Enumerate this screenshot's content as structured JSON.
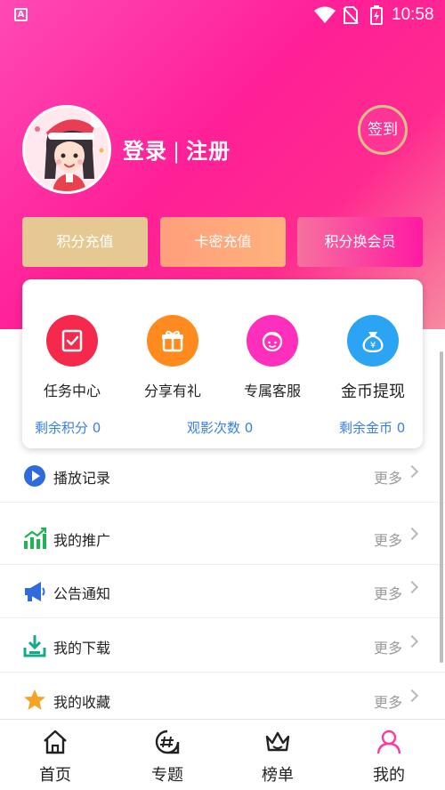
{
  "status_bar": {
    "time": "10:58",
    "notification_icon_letter": "A"
  },
  "profile": {
    "login_label": "登录",
    "separator": "|",
    "register_label": "注册",
    "signin_label": "签到"
  },
  "action_buttons": [
    {
      "label": "积分充值",
      "color": "#e6c992"
    },
    {
      "label": "卡密充值",
      "color": "#ffa87c"
    },
    {
      "label": "积分换会员",
      "color": "#ff3aa6"
    }
  ],
  "features": [
    {
      "label": "任务中心",
      "icon": "task-checklist-icon",
      "color": "#f4294c"
    },
    {
      "label": "分享有礼",
      "icon": "gift-icon",
      "color": "#ff8a1d"
    },
    {
      "label": "专属客服",
      "icon": "customer-service-icon",
      "color": "#ff2fbe"
    },
    {
      "label": "金币提现",
      "icon": "money-bag-icon",
      "color": "#2ba4f4"
    }
  ],
  "stats": [
    {
      "label": "剩余积分 0"
    },
    {
      "label": "观影次数 0"
    },
    {
      "label": "剩余金币 0"
    }
  ],
  "menu": [
    {
      "title": "播放记录",
      "more": "更多",
      "icon": "play-history-icon",
      "color": "#2f6bdc"
    },
    {
      "title": "我的推广",
      "more": "更多",
      "icon": "promotion-chart-icon",
      "color": "#1fb356"
    },
    {
      "title": "公告通知",
      "more": "更多",
      "icon": "megaphone-icon",
      "color": "#2f6bdc"
    },
    {
      "title": "我的下载",
      "more": "更多",
      "icon": "download-icon",
      "color": "#18a98a"
    },
    {
      "title": "我的收藏",
      "more": "更多",
      "icon": "star-icon",
      "color": "#f5a323"
    }
  ],
  "tabs": [
    {
      "label": "首页",
      "icon": "home-icon"
    },
    {
      "label": "专题",
      "icon": "topic-hashtag-icon"
    },
    {
      "label": "榜单",
      "icon": "crown-icon"
    },
    {
      "label": "我的",
      "icon": "user-icon",
      "active": true,
      "color": "#ff3a9e"
    }
  ]
}
